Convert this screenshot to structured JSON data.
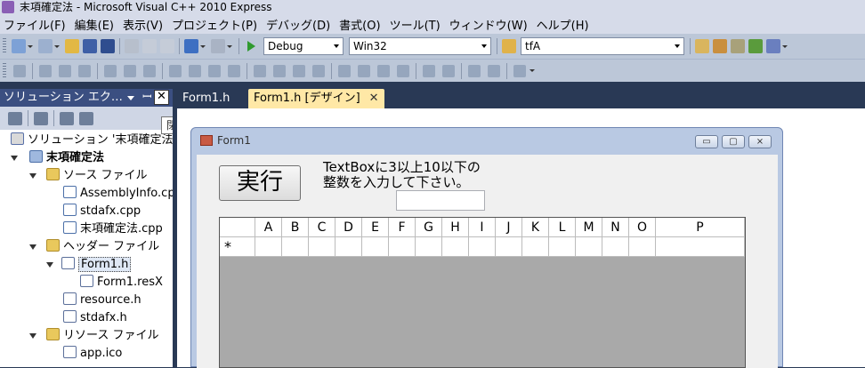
{
  "window": {
    "title": "末項確定法 - Microsoft Visual C++ 2010 Express"
  },
  "menu": [
    "ファイル(F)",
    "編集(E)",
    "表示(V)",
    "プロジェクト(P)",
    "デバッグ(D)",
    "書式(O)",
    "ツール(T)",
    "ウィンドウ(W)",
    "ヘルプ(H)"
  ],
  "toolbar": {
    "config": "Debug",
    "platform": "Win32",
    "find": "tfA"
  },
  "solution_explorer": {
    "title": "ソリューション エク…",
    "close_tooltip": "閉じる",
    "close_glyph": "✕",
    "pin_glyph": "ꟷ",
    "tree": {
      "solution": "ソリューション '末項確定法",
      "project": "末項確定法",
      "source_folder": "ソース ファイル",
      "source_files": [
        "AssemblyInfo.cpp",
        "stdafx.cpp",
        "末項確定法.cpp"
      ],
      "header_folder": "ヘッダー ファイル",
      "header_files": [
        "Form1.h",
        "Form1.resX",
        "resource.h",
        "stdafx.h"
      ],
      "resource_folder": "リソース ファイル",
      "resource_files": [
        "app.ico"
      ]
    }
  },
  "tabs": [
    {
      "label": "Form1.h"
    },
    {
      "label": "Form1.h [デザイン]",
      "close": "✕"
    }
  ],
  "form": {
    "title": "Form1",
    "minimize": "▭",
    "maximize": "▢",
    "close": "⨯",
    "button": "実行",
    "instruction_line1": "TextBoxに3以上10以下の",
    "instruction_line2": "整数を入力して下さい。",
    "grid": {
      "columns": [
        "A",
        "B",
        "C",
        "D",
        "E",
        "F",
        "G",
        "H",
        "I",
        "J",
        "K",
        "L",
        "M",
        "N",
        "O",
        "P"
      ],
      "new_row_marker": "*"
    }
  },
  "colors": {
    "ide_background": "#293955",
    "active_tab": "#ffe8a6",
    "grid_background": "#a9a9a9"
  }
}
